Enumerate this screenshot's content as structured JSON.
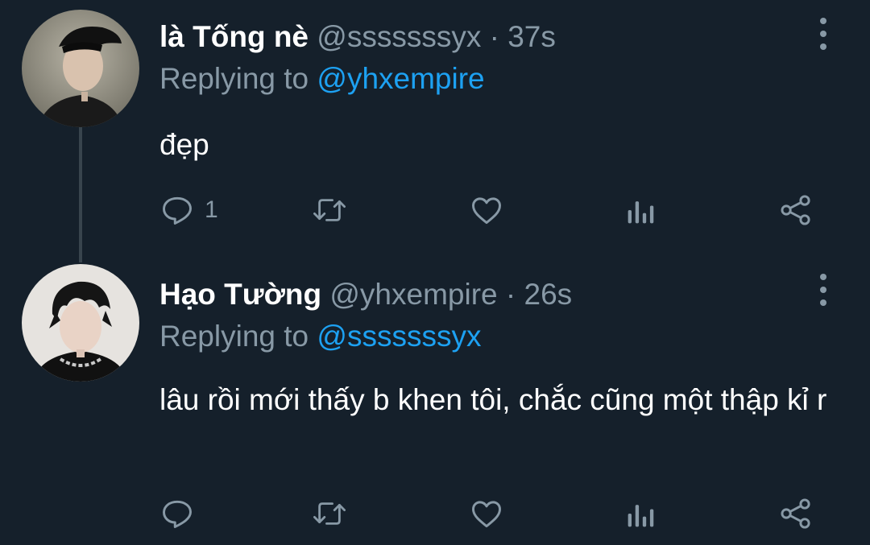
{
  "thread": [
    {
      "display_name": "là Tống nè",
      "handle": "@sssssssyx",
      "separator": "·",
      "time": "37s",
      "replying_prefix": "Replying to",
      "replying_to": "@yhxempire",
      "text": "đẹp",
      "reply_count": "1"
    },
    {
      "display_name": "Hạo Tường",
      "handle": "@yhxempire",
      "separator": "·",
      "time": "26s",
      "replying_prefix": "Replying to",
      "replying_to": "@sssssssyx",
      "text": "lâu rồi mới thấy b khen tôi, chắc cũng một thập kỉ r",
      "reply_count": ""
    }
  ],
  "icons": {
    "reply": "reply-icon",
    "retweet": "retweet-icon",
    "like": "heart-icon",
    "analytics": "analytics-icon",
    "share": "share-icon",
    "more": "more-options-icon"
  },
  "colors": {
    "background": "#15202b",
    "secondary_text": "#8899a6",
    "accent": "#1da1f2",
    "thread_line": "#38444d"
  }
}
